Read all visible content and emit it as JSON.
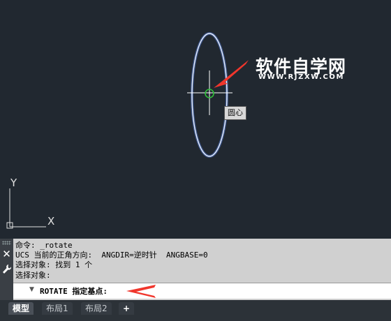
{
  "drawing": {
    "tooltip": "圆心",
    "watermark": {
      "title": "软件自学网",
      "url": "WWW.RJZXW.COM"
    },
    "ucs": {
      "x_label": "X",
      "y_label": "Y"
    }
  },
  "command_line": {
    "history": [
      "命令: _rotate",
      "UCS 当前的正角方向:  ANGDIR=逆时针  ANGBASE=0",
      "选择对象: 找到 1 个",
      "选择对象:"
    ],
    "prompt": "ROTATE 指定基点:"
  },
  "layout_tabs": [
    {
      "label": "模型",
      "active": true
    },
    {
      "label": "布局1",
      "active": false
    },
    {
      "label": "布局2",
      "active": false
    },
    {
      "label": "+",
      "active": false
    }
  ],
  "colors": {
    "canvas": "#212830",
    "ellipse_glow": "#7fa8ff",
    "center_marker": "#2fbf3a",
    "annotation_arrow": "#f0362c"
  }
}
